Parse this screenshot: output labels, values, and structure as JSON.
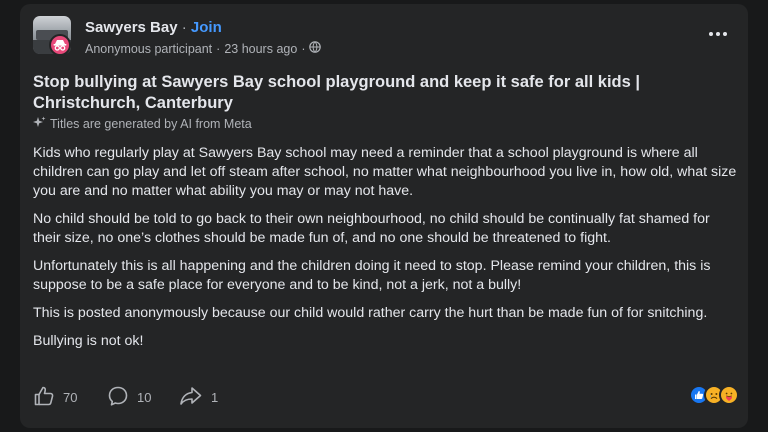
{
  "header": {
    "group_name": "Sawyers Bay",
    "separator": "·",
    "join_label": "Join",
    "author": "Anonymous participant",
    "timestamp": "23 hours ago",
    "visibility_icon": "globe-icon",
    "more_icon": "more-options-icon"
  },
  "post": {
    "title": "Stop bullying at Sawyers Bay school playground and keep it safe for all kids | Christchurch, Canterbury",
    "ai_note": "Titles are generated by AI from Meta",
    "paragraphs": [
      "Kids who regularly play at Sawyers Bay school may need a reminder that a school playground is where all children can go play and let off steam after school, no matter what neighbourhood you live in, how old, what size you are and no matter what ability you may or may not have.",
      "No child should be told to go back to their own neighbourhood, no child should be continually fat shamed for their size, no one’s clothes should be made fun of, and no one should be threatened to fight.",
      "Unfortunately this is all happening and the children doing it need to stop. Please remind your children, this is suppose to be a safe place for everyone and to be kind, not a jerk, not a bully!",
      "This is posted  anonymously because our child would rather carry the hurt than be made fun of for snitching.",
      "Bullying is not ok!"
    ]
  },
  "actions": {
    "like_count": "70",
    "comment_count": "10",
    "share_count": "1"
  },
  "reactions": [
    "like",
    "sad",
    "care"
  ],
  "colors": {
    "background": "#18191a",
    "card": "#242526",
    "text": "#e4e6eb",
    "secondary": "#b0b3b8",
    "link": "#4599ff",
    "anon_badge": "#e8497a"
  }
}
